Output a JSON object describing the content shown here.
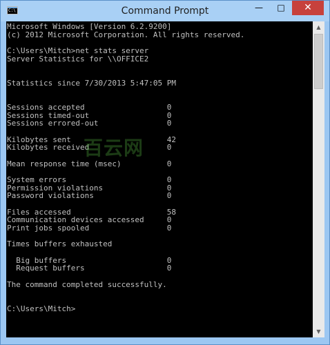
{
  "window": {
    "title": "Command Prompt",
    "icon": "console-icon"
  },
  "controls": {
    "minimize": "—",
    "maximize": "□",
    "close": "✕"
  },
  "console": {
    "lines": [
      "Microsoft Windows [Version 6.2.9200]",
      "(c) 2012 Microsoft Corporation. All rights reserved.",
      "C:\\Users\\Mitch>net stats server",
      "Server Statistics for \\\\OFFICE2",
      "Statistics since 7/30/2013 5:47:05 PM",
      "Sessions accepted                  0",
      "Sessions timed-out                 0",
      "Sessions errored-out               0",
      "Kilobytes sent                     42",
      "Kilobytes received                 0",
      "Mean response time (msec)          0",
      "System errors                      0",
      "Permission violations              0",
      "Password violations                0",
      "Files accessed                     58",
      "Communication devices accessed     0",
      "Print jobs spooled                 0",
      "Times buffers exhausted",
      "  Big buffers                      0",
      "  Request buffers                  0",
      "The command completed successfully.",
      "C:\\Users\\Mitch>"
    ]
  },
  "scrollbar": {
    "up_arrow": "▲",
    "down_arrow": "▼"
  },
  "watermark": "百云网"
}
